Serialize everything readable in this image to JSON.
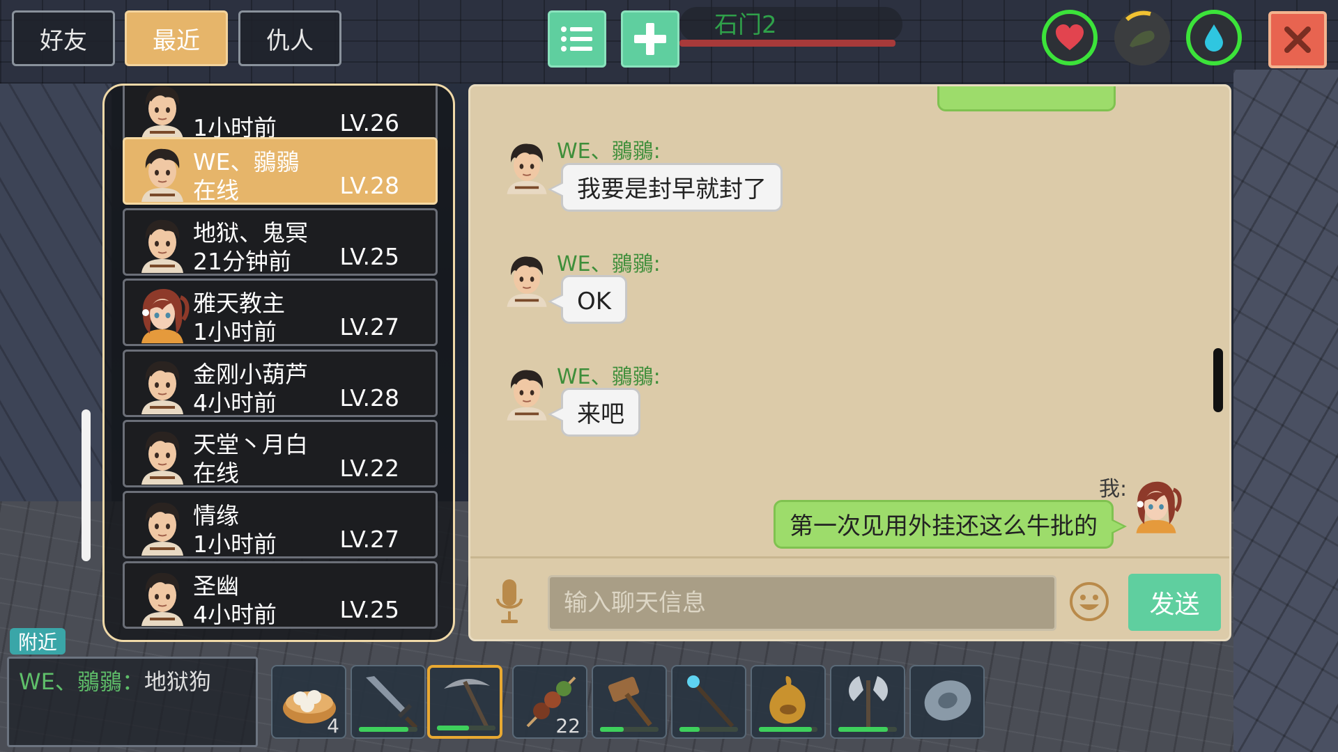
{
  "tabs": [
    {
      "label": "好友"
    },
    {
      "label": "最近"
    },
    {
      "label": "仇人"
    }
  ],
  "location": {
    "name": "石门2"
  },
  "friends": [
    {
      "name": "",
      "status": "1小时前",
      "level": "LV.26",
      "avatar": "boy"
    },
    {
      "name": "WE、鶸鶸",
      "status": "在线",
      "level": "LV.28",
      "avatar": "boy"
    },
    {
      "name": "地狱、鬼冥",
      "status": "21分钟前",
      "level": "LV.25",
      "avatar": "boy"
    },
    {
      "name": "雅天教主",
      "status": "1小时前",
      "level": "LV.27",
      "avatar": "girl"
    },
    {
      "name": "金刚小葫芦",
      "status": "4小时前",
      "level": "LV.28",
      "avatar": "boy"
    },
    {
      "name": "天堂丶月白",
      "status": "在线",
      "level": "LV.22",
      "avatar": "boy"
    },
    {
      "name": "情缘",
      "status": "1小时前",
      "level": "LV.27",
      "avatar": "boy"
    },
    {
      "name": "圣幽",
      "status": "4小时前",
      "level": "LV.25",
      "avatar": "boy"
    }
  ],
  "chat": {
    "messages": [
      {
        "sender": "WE、鶸鶸:",
        "text": "我要是封早就封了"
      },
      {
        "sender": "WE、鶸鶸:",
        "text": "OK"
      },
      {
        "sender": "WE、鶸鶸:",
        "text": "来吧"
      },
      {
        "sender": "我:",
        "text": "第一次见用外挂还这么牛批的"
      }
    ],
    "input_placeholder": "输入聊天信息",
    "send_label": "发送"
  },
  "nearby": {
    "tag": "附近",
    "sender": "WE、鶸鶸：",
    "text": "地狱狗"
  },
  "hotbar": [
    {
      "icon": "dumpling-steamer-icon",
      "qty": "4",
      "durability": null
    },
    {
      "icon": "sword-icon",
      "qty": "",
      "durability": 0.85
    },
    {
      "icon": "pickaxe-icon",
      "qty": "",
      "durability": 0.55
    },
    {
      "icon": "meat-skewer-icon",
      "qty": "22",
      "durability": null
    },
    {
      "icon": "wooden-hammer-icon",
      "qty": "",
      "durability": 0.4
    },
    {
      "icon": "crystal-staff-icon",
      "qty": "",
      "durability": 0.35
    },
    {
      "icon": "water-flask-icon",
      "qty": "",
      "durability": 0.9
    },
    {
      "icon": "battle-axe-icon",
      "qty": "",
      "durability": 0.85
    },
    {
      "icon": "stone-disc-icon",
      "qty": "",
      "durability": null
    }
  ],
  "colors": {
    "accent_gold": "#e6b56a",
    "accent_green": "#5fcf9f",
    "close_red": "#e86450",
    "name_green": "#3e8e3a"
  }
}
